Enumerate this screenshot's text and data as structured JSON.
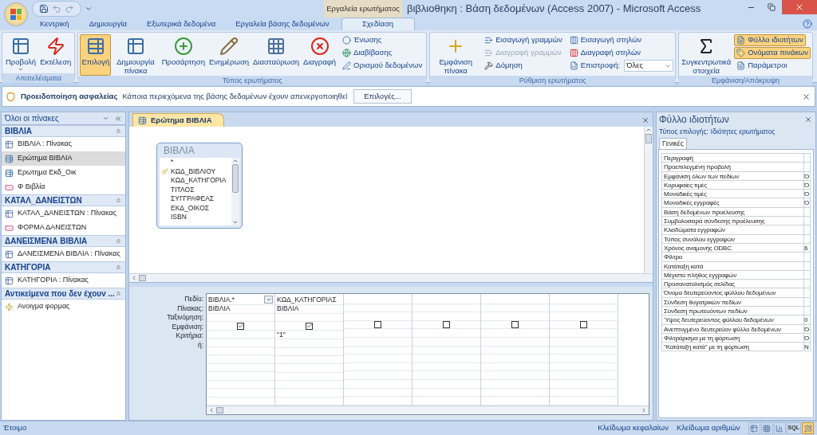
{
  "window": {
    "title": "βιβλιοθηκη : Βάση δεδομένων (Access 2007) - Microsoft Access",
    "context_label": "Εργαλεία ερωτήματος"
  },
  "ribbon_tabs": [
    {
      "label": "Κεντρική",
      "selected": false
    },
    {
      "label": "Δημιουργία",
      "selected": false
    },
    {
      "label": "Εξωτερικά δεδομένα",
      "selected": false
    },
    {
      "label": "Εργαλεία βάσης δεδομένων",
      "selected": false
    },
    {
      "label": "Σχεδίαση",
      "selected": true
    }
  ],
  "ribbon_groups": [
    {
      "title": "Αποτελέσματα",
      "large": [
        {
          "label": "Προβολή",
          "selected": false,
          "dropdown": true
        },
        {
          "label": "Εκτέλεση",
          "selected": false
        }
      ]
    },
    {
      "title": "Τύπος ερωτήματος",
      "large": [
        {
          "label": "Επιλογή",
          "selected": true
        },
        {
          "label": "Δημιουργία πίνακα",
          "selected": false
        },
        {
          "label": "Προσάρτηση",
          "selected": false
        },
        {
          "label": "Ενημέρωση",
          "selected": false
        },
        {
          "label": "Διασταύρωση",
          "selected": false
        },
        {
          "label": "Διαγραφή",
          "selected": false
        }
      ],
      "small_columns": [
        [
          {
            "label": "Ένωσης",
            "selected": false,
            "disabled": false
          },
          {
            "label": "Διαβίβασης",
            "selected": false,
            "disabled": false
          },
          {
            "label": "Ορισμού δεδομένων",
            "selected": false,
            "disabled": false
          }
        ]
      ]
    },
    {
      "title": "Ρύθμιση ερωτήματος",
      "large": [
        {
          "label": "Εμφάνιση πίνακα",
          "selected": false
        }
      ],
      "small_columns": [
        [
          {
            "label": "Εισαγωγή γραμμών",
            "selected": false,
            "disabled": false
          },
          {
            "label": "Διαγραφή γραμμών",
            "selected": false,
            "disabled": true
          },
          {
            "label": "Δόμηση",
            "selected": false,
            "disabled": false
          }
        ],
        [
          {
            "label": "Εισαγωγή στηλών",
            "selected": false,
            "disabled": false
          },
          {
            "label": "Διαγραφή στηλών",
            "selected": false,
            "disabled": false
          },
          {
            "label": "Επιστροφή:",
            "selected": false,
            "disabled": false,
            "value": "Όλες"
          }
        ]
      ]
    },
    {
      "title": "Εμφάνιση/Απόκρυψη",
      "large": [
        {
          "label": "Συγκεντρωτικά στοιχεία",
          "selected": false
        }
      ],
      "small_columns": [
        [
          {
            "label": "Φύλλο ιδιοτήτων",
            "selected": true,
            "disabled": false
          },
          {
            "label": "Ονόματα πινάκων",
            "selected": true,
            "disabled": false
          },
          {
            "label": "Παράμετροι",
            "selected": false,
            "disabled": false
          }
        ]
      ]
    }
  ],
  "security_bar": {
    "title": "Προειδοποίηση ασφαλείας",
    "message": "Κάποια περιεχόμενα της βάσης δεδομένων έχουν απενεργοποιηθεί",
    "button": "Επιλογές..."
  },
  "nav_pane": {
    "title": "Όλοι οι πίνακες",
    "groups": [
      {
        "title": "ΒΙΒΛΙΑ",
        "items": [
          {
            "label": "ΒΙΒΛΙΑ : Πίνακας",
            "kind": "table",
            "selected": false
          },
          {
            "label": "Ερώτημα ΒΙΒΛΙΑ",
            "kind": "query",
            "selected": true
          },
          {
            "label": "Ερωτημα Εκδ_Οικ",
            "kind": "query",
            "selected": false
          },
          {
            "label": "Φ Βιβλία",
            "kind": "form",
            "selected": false
          }
        ]
      },
      {
        "title": "ΚΑΤΑΛ_ΔΑΝΕΙΣΤΩΝ",
        "items": [
          {
            "label": "ΚΑΤΑΛ_ΔΑΝΕΙΣΤΩΝ : Πίνακας",
            "kind": "table",
            "selected": false
          },
          {
            "label": "ΦΟΡΜΑ ΔΑΝΕΙΣΤΩΝ",
            "kind": "form",
            "selected": false
          }
        ]
      },
      {
        "title": "ΔΑΝΕΙΣΜΕΝΑ ΒΙΒΛΙΑ",
        "items": [
          {
            "label": "ΔΑΝΕΙΣΜΕΝΑ ΒΙΒΛΙΑ : Πίνακας",
            "kind": "table",
            "selected": false
          }
        ]
      },
      {
        "title": "ΚΑΤΗΓΟΡΙΑ",
        "items": [
          {
            "label": "ΚΑΤΗΓΟΡΙΑ : Πίνακας",
            "kind": "table",
            "selected": false
          }
        ]
      },
      {
        "title": "Αντικείμενα που δεν έχουν ...",
        "items": [
          {
            "label": "Ανοιγμα φορμας",
            "kind": "macro",
            "selected": false
          }
        ]
      }
    ]
  },
  "document_tab": {
    "label": "Ερώτημα ΒΙΒΛΙΑ"
  },
  "field_list": {
    "title": "ΒΙΒΛΙΑ",
    "fields": [
      {
        "name": "*",
        "key": false
      },
      {
        "name": "ΚΩΔ_ΒΙΒΛΙΟΥ",
        "key": true
      },
      {
        "name": "ΚΩΔ_ΚΑΤΗΓΟΡΙΑ",
        "key": false
      },
      {
        "name": "ΤΙΤΛΟΣ",
        "key": false
      },
      {
        "name": "ΣΥΓΓΡΑΦΕΑΣ",
        "key": false
      },
      {
        "name": "ΕΚΔ_ΟΙΚΟΣ",
        "key": false
      },
      {
        "name": "ISBN",
        "key": false
      }
    ]
  },
  "design_grid": {
    "row_labels": [
      "Πεδίο:",
      "Πίνακας:",
      "Ταξινόμηση:",
      "Εμφάνιση:",
      "Κριτήρια:",
      "ή:"
    ],
    "columns": [
      {
        "field": "ΒΙΒΛΙΑ.*",
        "table": "ΒΙΒΛΙΑ",
        "show": true,
        "dropdown": true
      },
      {
        "field": "ΚΩΔ_ΚΑΤΗΓΟΡΙΑΣ",
        "table": "ΒΙΒΛΙΑ",
        "criteria": "\"1\"",
        "show": true
      },
      {
        "show": false
      },
      {
        "show": false
      },
      {
        "show": false
      },
      {
        "show": false
      }
    ]
  },
  "property_sheet": {
    "title": "Φύλλο ιδιοτήτων",
    "selection_label": "Τύπος επιλογής:",
    "selection_value": "Ιδιότητες ερωτήματος",
    "tab": "Γενικές",
    "rows": [
      {
        "label": "Περιγραφή"
      },
      {
        "label": "Προεπιλεγμένη προβολή"
      },
      {
        "label": "Εμφάνιση όλων των πεδίων",
        "value": "Ό"
      },
      {
        "label": "Κορυφαίες τιμές",
        "value": "Ό"
      },
      {
        "label": "Μοναδικές τιμές",
        "value": "Ό"
      },
      {
        "label": "Μοναδικές εγγραφές",
        "value": "Ό"
      },
      {
        "label": "Βάση δεδομένων προέλευσης"
      },
      {
        "label": "Συμβολοσειρά σύνδεσης προέλευσης"
      },
      {
        "label": "Κλειδώματα εγγραφών"
      },
      {
        "label": "Τύπος συνόλου εγγραφών"
      },
      {
        "label": "Χρόνος αναμονής ODBC",
        "value": "6"
      },
      {
        "label": "Φίλτρο"
      },
      {
        "label": "Κατάταξη κατά"
      },
      {
        "label": "Μέγιστο πλήθος εγγραφών"
      },
      {
        "label": "Προσανατολισμός σελίδας"
      },
      {
        "label": "Όνομα δευτερεύοντος φύλλου δεδομένων"
      },
      {
        "label": "Σύνδεση θυγατρικών πεδίων"
      },
      {
        "label": "Σύνδεση πρωτευόντων πεδίων"
      },
      {
        "label": "Ύψος δευτερεύοντος φύλλου δεδομένων",
        "value": "0"
      },
      {
        "label": "Ανεπτυγμένο δευτερεύον φύλλο δεδομένων",
        "value": "Ό"
      },
      {
        "label": "Φιλτράρισμα με τη φόρτωση",
        "value": "Ό"
      },
      {
        "label": "\"Κατάταξη κατά\" με τη φόρτωση",
        "value": "Ν"
      }
    ]
  },
  "status_bar": {
    "text": "Έτοιμο",
    "indicators": [
      "Κλείδωμα κεφαλαίων",
      "Κλείδωμα αριθμών"
    ],
    "views": [
      {
        "kind": "datasheet",
        "selected": false
      },
      {
        "kind": "pivot-table",
        "selected": false
      },
      {
        "kind": "pivot-chart",
        "selected": false
      },
      {
        "kind": "sql",
        "label": "SQL",
        "selected": false
      },
      {
        "kind": "design",
        "selected": true
      }
    ]
  }
}
